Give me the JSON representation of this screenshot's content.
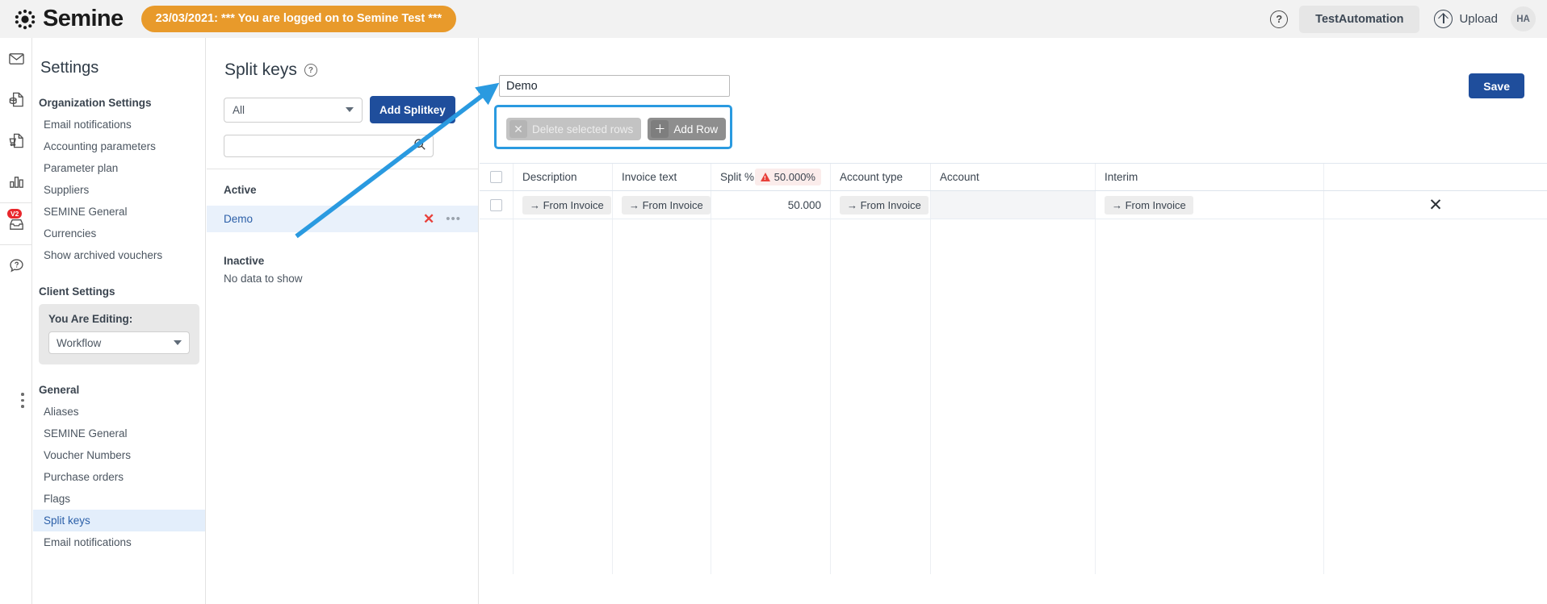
{
  "header": {
    "logo_text": "Semine",
    "banner": "23/03/2021: *** You are logged on to Semine Test ***",
    "help_icon": "question-mark-icon",
    "tenant_button": "TestAutomation",
    "upload_label": "Upload",
    "avatar_initials": "HA"
  },
  "rail": {
    "items": [
      {
        "name": "mail-icon",
        "badge": ""
      },
      {
        "name": "invoice-icon",
        "badge": ""
      },
      {
        "name": "purchase-icon",
        "badge": ""
      },
      {
        "name": "chart-icon",
        "badge": ""
      },
      {
        "name": "inbox-icon",
        "badge": "V2"
      },
      {
        "name": "help-icon",
        "badge": ""
      }
    ],
    "more_dots": "more-options-icon"
  },
  "settings": {
    "title": "Settings",
    "org_group": "Organization Settings",
    "org_items": [
      "Email notifications",
      "Accounting parameters",
      "Parameter plan",
      "Suppliers",
      "SEMINE General",
      "Currencies",
      "Show archived vouchers"
    ],
    "client_group": "Client Settings",
    "editing_label": "You Are Editing:",
    "editing_value": "Workflow",
    "general_group": "General",
    "general_items": [
      "Aliases",
      "SEMINE General",
      "Voucher Numbers",
      "Purchase orders",
      "Flags",
      "Split keys",
      "Email notifications"
    ],
    "active_item": "Split keys"
  },
  "splitpanel": {
    "title": "Split keys",
    "help_icon": "question-mark-icon",
    "filter_value": "All",
    "add_button": "Add Splitkey",
    "search_value": "",
    "search_placeholder": "",
    "active_heading": "Active",
    "active_items": [
      {
        "label": "Demo",
        "delete_icon": "close-x-icon",
        "menu_icon": "ellipsis-icon"
      }
    ],
    "inactive_heading": "Inactive",
    "inactive_empty": "No data to show"
  },
  "main": {
    "name_value": "Demo",
    "name_placeholder": "",
    "save_label": "Save",
    "toolbar": {
      "delete_rows_label": "Delete selected rows",
      "delete_rows_icon": "close-x-icon",
      "add_row_label": "Add Row",
      "add_row_icon": "plus-icon"
    },
    "table": {
      "columns": [
        "Description",
        "Invoice text",
        "Split %",
        "Account type",
        "Account",
        "Interim"
      ],
      "split_total": "50.000%",
      "split_total_icon": "warning-triangle-icon",
      "rows": [
        {
          "description": "→ From Invoice",
          "invoice_text": "→ From Invoice",
          "split_pct": "50.000",
          "account_type": "→ From Invoice",
          "account": "",
          "interim": "→ From Invoice",
          "delete_icon": "close-x-icon"
        }
      ]
    }
  },
  "annotations": {
    "highlight_color": "#2a9ae0",
    "arrow_color": "#2a9ae0"
  }
}
